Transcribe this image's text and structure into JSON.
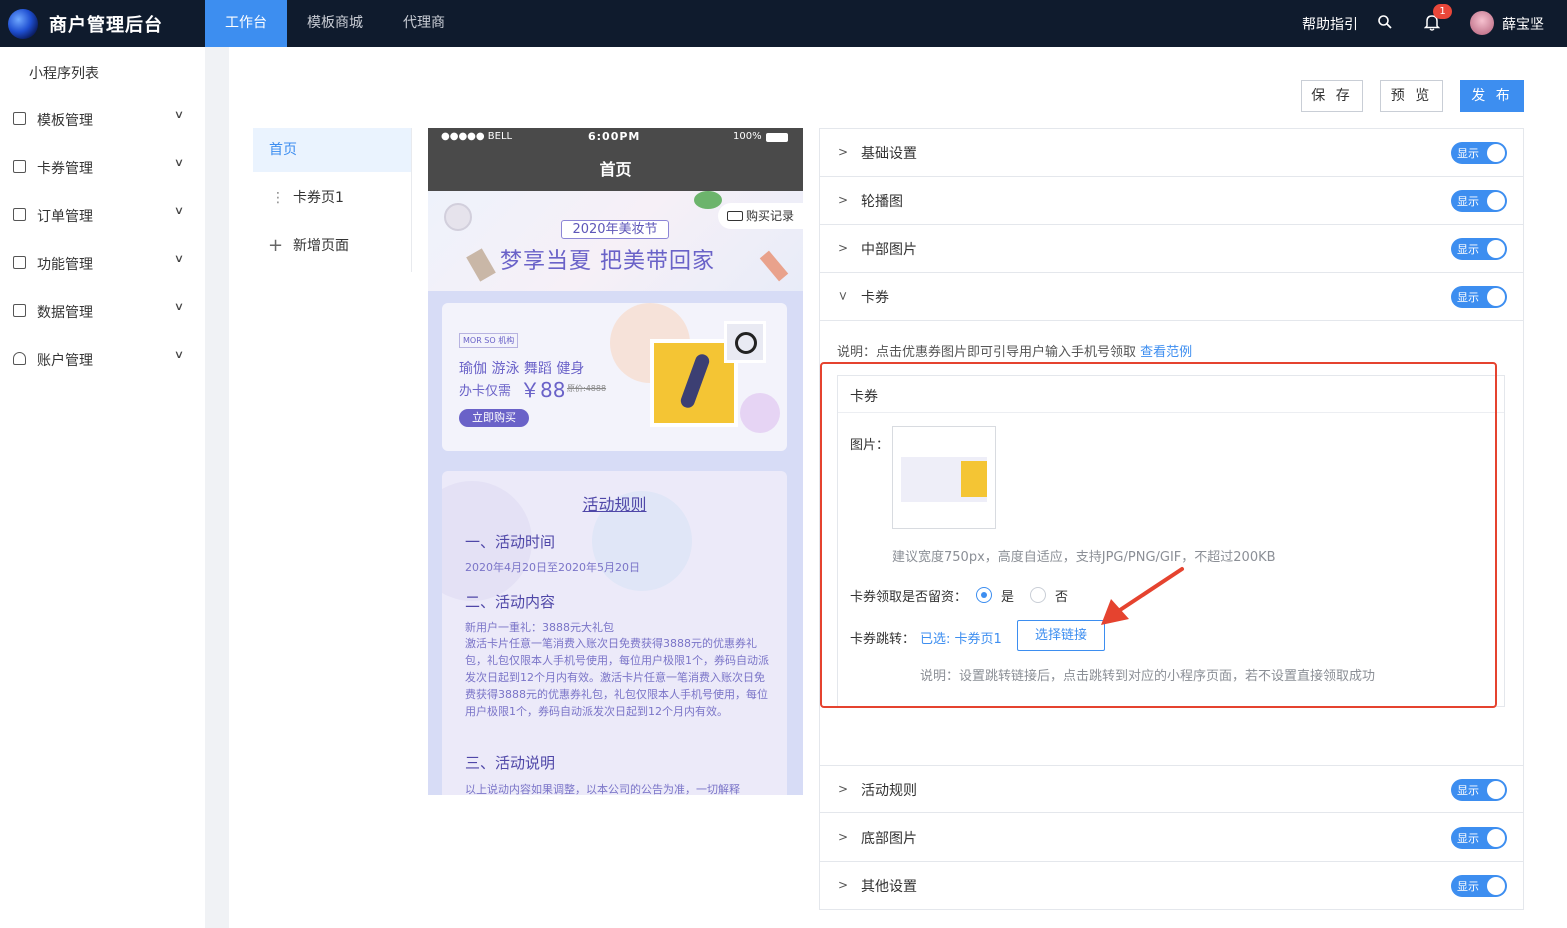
{
  "app": {
    "title": "商户管理后台",
    "tabs": [
      "工作台",
      "模板商城",
      "代理商"
    ],
    "help": "帮助指引",
    "notification_count": "1",
    "user": "薛宝坚"
  },
  "sidebar": {
    "title": "小程序列表",
    "items": [
      {
        "label": "模板管理",
        "icon": "template-icon"
      },
      {
        "label": "卡券管理",
        "icon": "card-icon"
      },
      {
        "label": "订单管理",
        "icon": "order-icon"
      },
      {
        "label": "功能管理",
        "icon": "function-icon"
      },
      {
        "label": "数据管理",
        "icon": "data-icon"
      },
      {
        "label": "账户管理",
        "icon": "user-icon"
      }
    ]
  },
  "toolbar": {
    "save": "保 存",
    "preview": "预 览",
    "publish": "发 布"
  },
  "pages": {
    "items": [
      "首页",
      "卡券页1",
      "新增页面"
    ]
  },
  "phone": {
    "carrier": "●●●●● BELL",
    "time": "6:00PM",
    "battery": "100%",
    "title": "首页",
    "banner": {
      "subtitle": "2020年美妆节",
      "headline": "梦享当夏 把美带回家",
      "record": "购买记录"
    },
    "card": {
      "brand": "MOR SO 机构",
      "line1": "瑜伽 游泳 舞蹈 健身",
      "line2": "办卡仅需",
      "price": "￥88",
      "orig": "原价:4888",
      "buy": "立即购买"
    },
    "rules": {
      "title": "活动规则",
      "s1": "一、活动时间",
      "t1": "2020年4月20日至2020年5月20日",
      "s2": "二、活动内容",
      "t2a": "新用户一重礼：3888元大礼包",
      "t2b": "激活卡片任意一笔消费入账次日免费获得3888元的优惠券礼包，礼包仅限本人手机号使用，每位用户极限1个，券码自动派发次日起到12个月内有效。激活卡片任意一笔消费入账次日免费获得3888元的优惠券礼包，礼包仅限本人手机号使用，每位用户极限1个，券码自动派发次日起到12个月内有效。",
      "s3": "三、活动说明",
      "t3": "以上说动内容如果调整，以本公司的公告为准，一切解释"
    }
  },
  "settings": {
    "toggle_label": "显示",
    "sections": [
      "基础设置",
      "轮播图",
      "中部图片",
      "卡券",
      "活动规则",
      "底部图片",
      "其他设置"
    ],
    "coupon": {
      "note": "说明：点击优惠券图片即可引导用户输入手机号领取",
      "example_link": "查看范例",
      "box_title": "卡券",
      "image_label": "图片：",
      "image_hint": "建议宽度750px，高度自适应，支持JPG/PNG/GIF，不超过200KB",
      "retain_label": "卡券领取是否留资：",
      "yes": "是",
      "no": "否",
      "jump_label": "卡券跳转：",
      "jump_value": "已选: 卡券页1",
      "select_link": "选择链接",
      "jump_note": "说明：设置跳转链接后，点击跳转到对应的小程序页面，若不设置直接领取成功"
    }
  },
  "colors": {
    "accent": "#3d8ef0",
    "topbar": "#0f1b2d",
    "highlight": "#e5432f"
  }
}
